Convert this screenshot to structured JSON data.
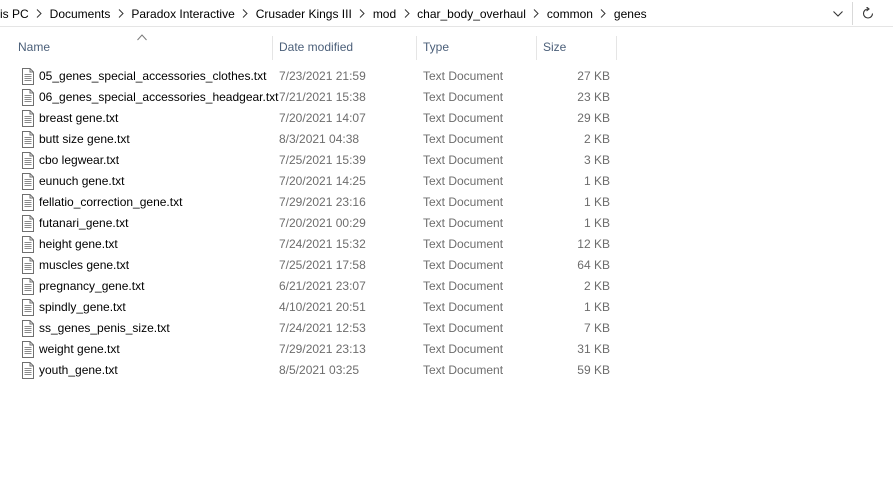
{
  "breadcrumb": [
    "is PC",
    "Documents",
    "Paradox Interactive",
    "Crusader Kings III",
    "mod",
    "char_body_overhaul",
    "common",
    "genes"
  ],
  "icons": {
    "separator": "chevron-right-icon",
    "dropdown": "chevron-down-icon",
    "refresh": "refresh-icon",
    "file": "text-file-icon",
    "sort": "sort-ascending-icon"
  },
  "columns": {
    "name": "Name",
    "date": "Date modified",
    "type": "Type",
    "size": "Size"
  },
  "files": [
    {
      "name": "05_genes_special_accessories_clothes.txt",
      "date": "7/23/2021 21:59",
      "type": "Text Document",
      "size": "27 KB"
    },
    {
      "name": "06_genes_special_accessories_headgear.txt",
      "date": "7/21/2021 15:38",
      "type": "Text Document",
      "size": "23 KB"
    },
    {
      "name": "breast gene.txt",
      "date": "7/20/2021 14:07",
      "type": "Text Document",
      "size": "29 KB"
    },
    {
      "name": "butt size gene.txt",
      "date": "8/3/2021 04:38",
      "type": "Text Document",
      "size": "2 KB"
    },
    {
      "name": "cbo legwear.txt",
      "date": "7/25/2021 15:39",
      "type": "Text Document",
      "size": "3 KB"
    },
    {
      "name": "eunuch gene.txt",
      "date": "7/20/2021 14:25",
      "type": "Text Document",
      "size": "1 KB"
    },
    {
      "name": "fellatio_correction_gene.txt",
      "date": "7/29/2021 23:16",
      "type": "Text Document",
      "size": "1 KB"
    },
    {
      "name": "futanari_gene.txt",
      "date": "7/20/2021 00:29",
      "type": "Text Document",
      "size": "1 KB"
    },
    {
      "name": "height gene.txt",
      "date": "7/24/2021 15:32",
      "type": "Text Document",
      "size": "12 KB"
    },
    {
      "name": "muscles gene.txt",
      "date": "7/25/2021 17:58",
      "type": "Text Document",
      "size": "64 KB"
    },
    {
      "name": "pregnancy_gene.txt",
      "date": "6/21/2021 23:07",
      "type": "Text Document",
      "size": "2 KB"
    },
    {
      "name": "spindly_gene.txt",
      "date": "4/10/2021 20:51",
      "type": "Text Document",
      "size": "1 KB"
    },
    {
      "name": "ss_genes_penis_size.txt",
      "date": "7/24/2021 12:53",
      "type": "Text Document",
      "size": "7 KB"
    },
    {
      "name": "weight gene.txt",
      "date": "7/29/2021 23:13",
      "type": "Text Document",
      "size": "31 KB"
    },
    {
      "name": "youth_gene.txt",
      "date": "8/5/2021 03:25",
      "type": "Text Document",
      "size": "59 KB"
    }
  ]
}
